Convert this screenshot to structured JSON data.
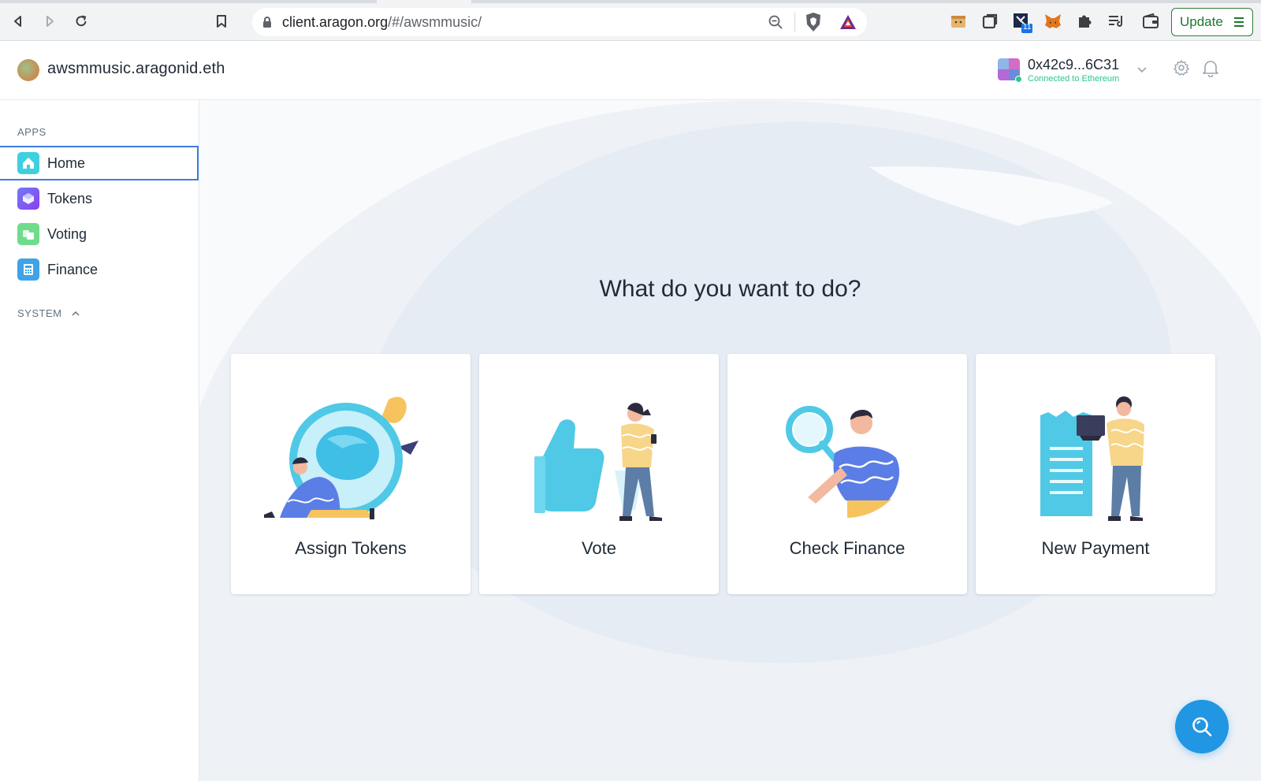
{
  "browser": {
    "url_host": "client.aragon.org",
    "url_path": "/#/awsmmusic/",
    "extension_badge": "11",
    "update_label": "Update"
  },
  "header": {
    "org_name": "awsmmusic.aragonid.eth",
    "account_address": "0x42c9...6C31",
    "connection_status": "Connected to Ethereum"
  },
  "sidebar": {
    "apps_title": "APPS",
    "items": [
      {
        "label": "Home",
        "icon": "home-icon",
        "active": true
      },
      {
        "label": "Tokens",
        "icon": "tokens-icon"
      },
      {
        "label": "Voting",
        "icon": "voting-icon"
      },
      {
        "label": "Finance",
        "icon": "finance-icon"
      }
    ],
    "system_title": "SYSTEM"
  },
  "main": {
    "title": "What do you want to do?",
    "cards": [
      {
        "label": "Assign Tokens"
      },
      {
        "label": "Vote"
      },
      {
        "label": "Check Finance"
      },
      {
        "label": "New Payment"
      }
    ]
  },
  "colors": {
    "accent": "#3f7ddc",
    "fab": "#2196e3",
    "connected": "#2cc68f"
  }
}
